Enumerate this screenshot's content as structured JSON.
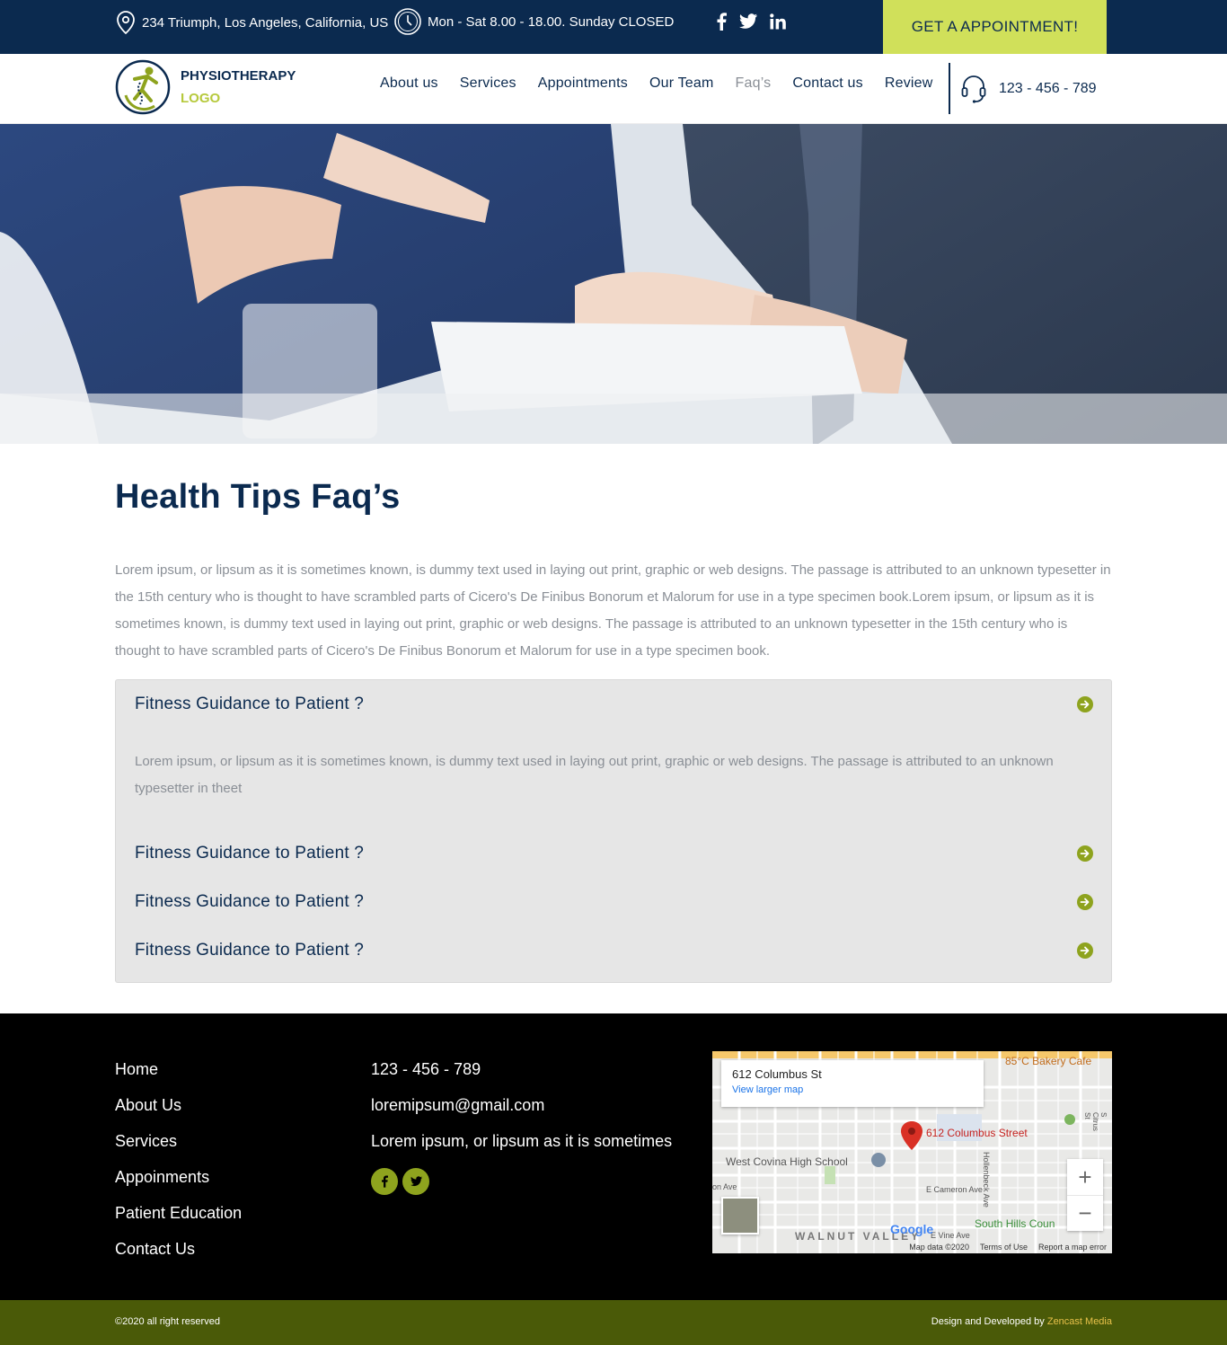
{
  "topbar": {
    "address": "234 Triumph, Los Angeles, California, US",
    "hours": "Mon - Sat 8.00 - 18.00. Sunday CLOSED",
    "socials": [
      "facebook-icon",
      "twitter-icon",
      "linkedin-icon"
    ],
    "cta": "GET A APPOINTMENT!",
    "colors": {
      "bar": "#0b2a4f",
      "cta": "#d0e05a"
    }
  },
  "nav": {
    "logo_line1": "PHYSIOTHERAPY",
    "logo_line2": "LOGO",
    "items": [
      {
        "label": "About us"
      },
      {
        "label": "Services"
      },
      {
        "label": "Appointments"
      },
      {
        "label": "Our Team"
      },
      {
        "label": "Faq’s",
        "active": true
      },
      {
        "label": "Contact us"
      },
      {
        "label": "Review"
      }
    ],
    "phone": "123 - 456 - 789"
  },
  "main": {
    "title": "Health Tips Faq’s",
    "intro": "Lorem ipsum, or lipsum as it is sometimes known, is dummy text used in laying out print, graphic or web designs. The passage is attributed to an unknown typesetter in the 15th century who is thought to have scrambled parts of Cicero's De Finibus Bonorum et Malorum for use in a type specimen book.Lorem ipsum, or lipsum as it is sometimes known, is dummy text used in laying out print, graphic or web designs. The passage is attributed to an unknown typesetter in the 15th century who is thought to have scrambled parts of Cicero's De Finibus Bonorum et Malorum for use in a type specimen book.",
    "faqs": [
      {
        "question": "Fitness Guidance to Patient ?",
        "answer": "Lorem ipsum, or lipsum as it is sometimes known, is dummy text used in laying out print, graphic or web designs. The passage is attributed to an unknown typesetter in theet"
      },
      {
        "question": "Fitness Guidance to Patient ?"
      },
      {
        "question": "Fitness Guidance to Patient ?"
      },
      {
        "question": "Fitness Guidance to Patient ?"
      }
    ],
    "accent": "#8ea31e"
  },
  "footer": {
    "links": [
      "Home",
      "About Us",
      "Services",
      "Appoinments",
      "Patient Education",
      "Contact Us"
    ],
    "phone": "123 - 456 - 789",
    "email": "loremipsum@gmail.com",
    "tagline": "Lorem ipsum, or lipsum as it is sometimes",
    "map": {
      "card_title": "612 Columbus St",
      "card_link": "View larger map",
      "pin_label": "612 Columbus Street",
      "labels": [
        "85°C Bakery Cafe",
        "West Covina High School",
        "E Cameron Ave",
        "Hollenbeck Ave",
        "South Hills Coun",
        "WALNUT VALLEY",
        "E Vine Ave",
        "S Citrus St",
        "on Ave"
      ],
      "zoom_in": "+",
      "zoom_out": "−",
      "google": "Google",
      "map_data": "Map data ©2020",
      "terms": "Terms of Use",
      "report": "Report a map error"
    }
  },
  "bottom": {
    "copyright": "©2020 all right reserved",
    "credit_prefix": "Design and Developed by",
    "credit_brand": "Zencast Media"
  }
}
